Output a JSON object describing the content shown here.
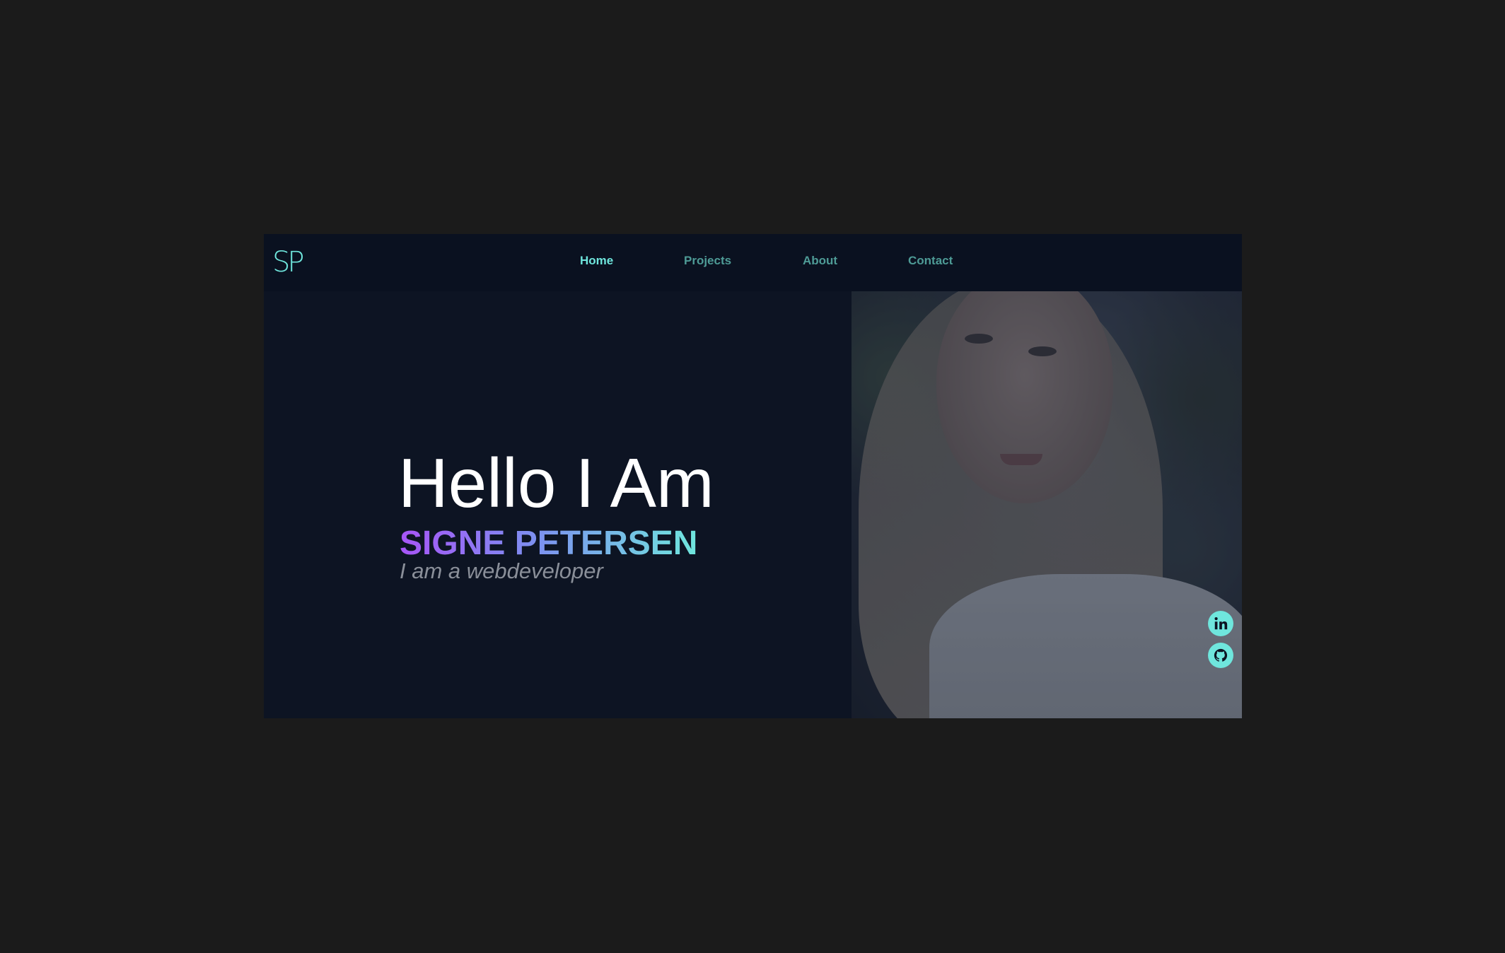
{
  "brand": {
    "logo_text": "SP"
  },
  "nav": {
    "items": [
      {
        "label": "Home",
        "active": true
      },
      {
        "label": "Projects",
        "active": false
      },
      {
        "label": "About",
        "active": false
      },
      {
        "label": "Contact",
        "active": false
      }
    ]
  },
  "hero": {
    "greeting": "Hello I Am",
    "name": "SIGNE PETERSEN",
    "tagline": "I am a webdeveloper"
  },
  "social": [
    {
      "icon": "linkedin-icon"
    },
    {
      "icon": "github-icon"
    }
  ],
  "colors": {
    "background": "#1b1b1b",
    "page": "#0d1423",
    "navbar": "#0a1120",
    "accent": "#6fe6dd",
    "nav_inactive": "#4e9b96",
    "name_gradient_start": "#a855f7",
    "name_gradient_end": "#6fe6dd",
    "tagline": "#8a8f99"
  }
}
